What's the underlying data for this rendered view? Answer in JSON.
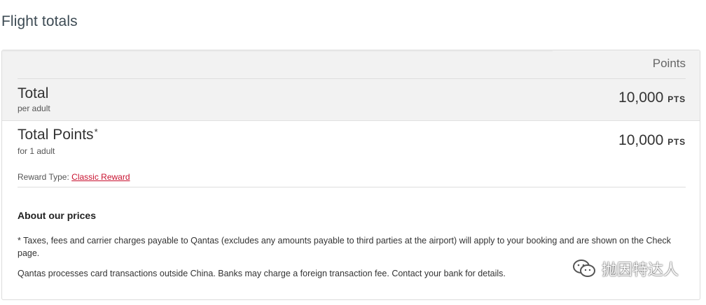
{
  "page": {
    "title": "Flight totals"
  },
  "table": {
    "column_header": "Points"
  },
  "total": {
    "label": "Total",
    "sub": "per adult",
    "amount": "10,000",
    "unit": "PTS"
  },
  "total_points": {
    "label": "Total Points",
    "asterisk": "*",
    "sub": "for 1 adult",
    "amount": "10,000",
    "unit": "PTS"
  },
  "reward": {
    "label": "Reward Type:",
    "link": "Classic Reward",
    "link_color": "#c8102e"
  },
  "about": {
    "title": "About our prices",
    "note1": "* Taxes, fees and carrier charges payable to Qantas (excludes any amounts payable to third parties at the airport) will apply to your booking and are shown on the Check page.",
    "note2": "Qantas processes card transactions outside China. Banks may charge a foreign transaction fee. Contact your bank for details."
  },
  "watermark": {
    "text": "抛因特达人",
    "icon": "wechat-icon"
  }
}
